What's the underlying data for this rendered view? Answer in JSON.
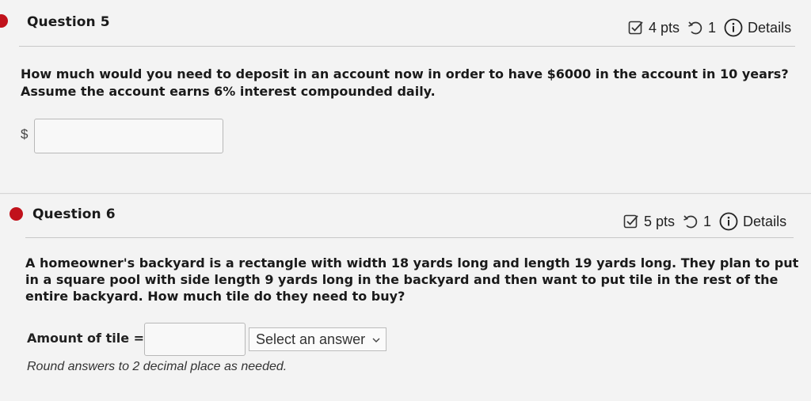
{
  "question5": {
    "title": "Question 5",
    "points": "4 pts",
    "attempts": "1",
    "details_label": "Details",
    "text_line1": "How much would you need to deposit in an account now in order to have $6000 in the account in 10 years?",
    "text_line2": "Assume the account earns 6% interest compounded daily.",
    "currency_prefix": "$",
    "answer_value": ""
  },
  "question6": {
    "title": "Question 6",
    "points": "5 pts",
    "attempts": "1",
    "details_label": "Details",
    "text_line1": "A homeowner's backyard is a rectangle with width 18 yards long and length 19 yards long. They plan to put",
    "text_line2": "in a square pool with side length 9 yards long in the backyard and then want to put tile in the rest of the",
    "text_line3": "entire backyard. How much tile do they need to buy?",
    "answer_label": "Amount of tile =",
    "answer_value": "",
    "unit_select_value": "Select an answer",
    "hint": "Round answers to 2 decimal place as needed."
  },
  "icons": {
    "status": "red-dot",
    "points": "checkbox-icon",
    "attempts": "retry-icon",
    "details": "info-icon"
  },
  "colors": {
    "status_bullet": "#c1121b"
  }
}
